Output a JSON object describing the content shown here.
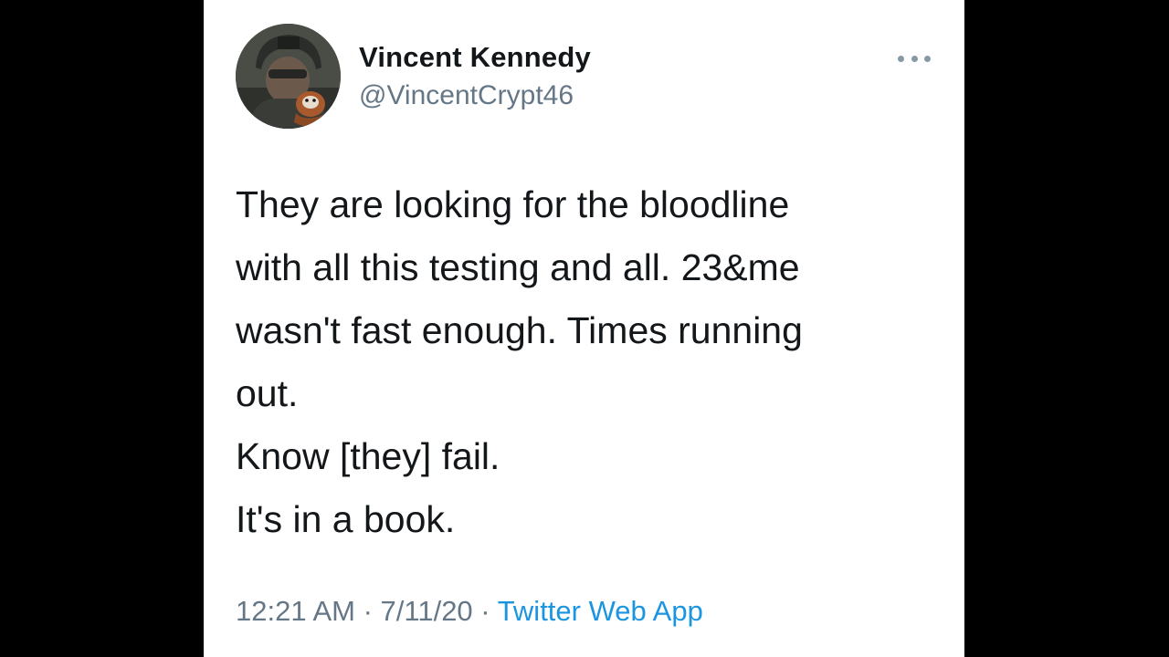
{
  "tweet": {
    "author": {
      "name": "Vincent Kennedy",
      "handle": "@VincentCrypt46"
    },
    "text_lines": [
      "They are looking for the bloodline",
      "with all this testing and all. 23&me",
      "wasn't fast enough. Times running",
      "out.",
      "Know [they] fail.",
      "It's in a book."
    ],
    "time": "12:21 AM",
    "separator_1": " · ",
    "date": "7/11/20",
    "separator_2": " · ",
    "source": "Twitter Web App"
  },
  "icons": {
    "more": "more-horizontal-icon",
    "avatar": "avatar-photo"
  },
  "colors": {
    "background": "#000000",
    "card": "#ffffff",
    "text": "#14171a",
    "muted": "#657786",
    "link": "#1b95e0"
  }
}
